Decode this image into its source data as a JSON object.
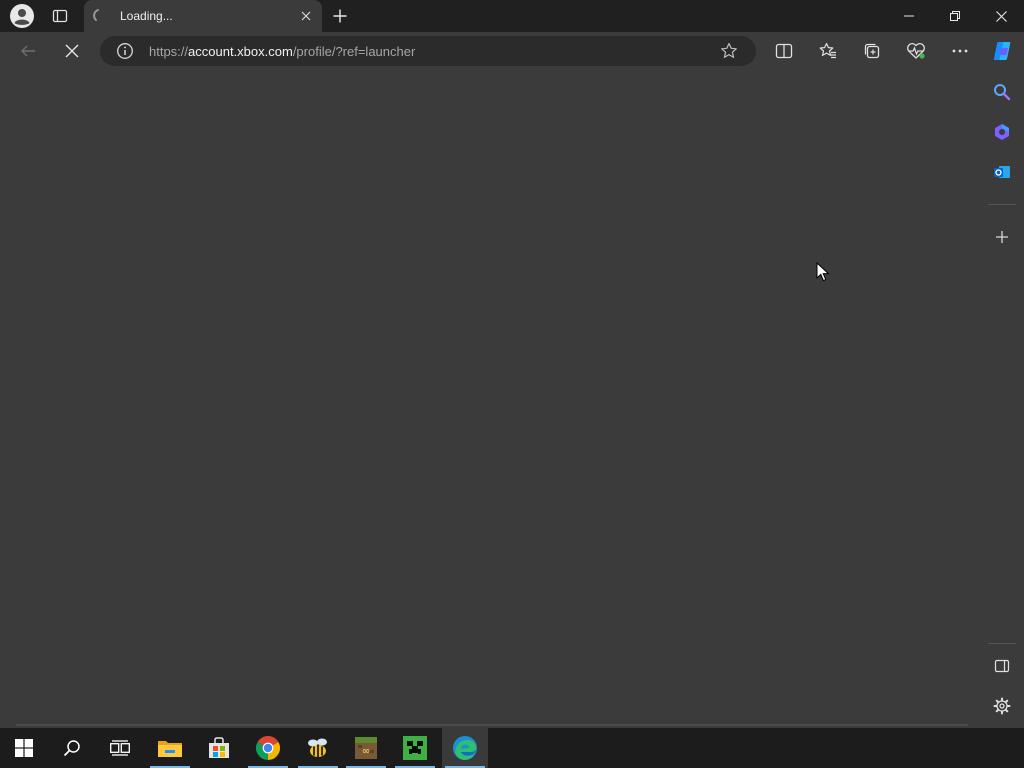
{
  "browser": {
    "tab": {
      "title": "Loading..."
    },
    "address": {
      "scheme": "https://",
      "domain": "account.xbox.com",
      "path": "/profile/?ref=launcher"
    }
  },
  "icons": {
    "tabbar": [
      "profile-icon",
      "tab-actions-icon",
      "loading-spinner-icon",
      "close-tab-icon",
      "new-tab-icon",
      "minimize-icon",
      "restore-icon",
      "close-window-icon"
    ],
    "toolbar": [
      "back-icon",
      "stop-loading-icon",
      "site-info-icon",
      "favorite-star-icon",
      "split-screen-icon",
      "favorites-icon",
      "collections-icon",
      "browser-essentials-icon",
      "more-icon",
      "copilot-icon"
    ],
    "sidebar": [
      "search-icon",
      "copilot-sidebar-icon",
      "outlook-icon",
      "add-icon",
      "hide-sidebar-icon",
      "settings-icon"
    ],
    "taskbar": [
      "windows-start-icon",
      "taskbar-search-icon",
      "task-view-icon",
      "file-explorer-icon",
      "microsoft-store-icon",
      "chrome-icon",
      "bee-app-icon",
      "minecraft-launcher-icon",
      "minecraft-icon",
      "edge-icon"
    ]
  },
  "colors": {
    "content_bg": "#3b3b3b",
    "tabbar_bg": "#202020",
    "taskbar_bg": "#1c1c1c",
    "active_indicator": "#76b9ed"
  }
}
